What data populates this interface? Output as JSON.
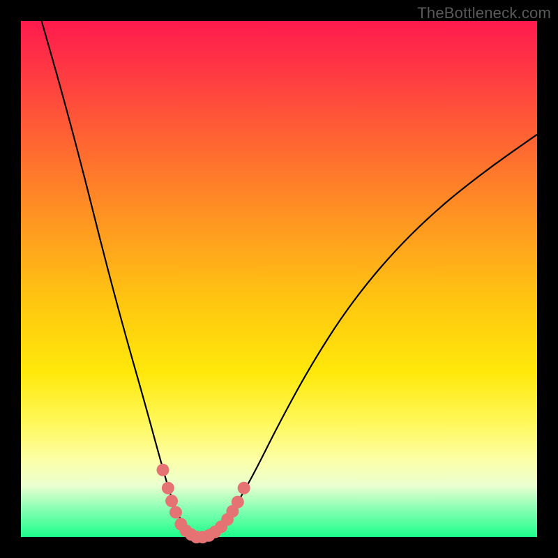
{
  "watermark": "TheBottleneck.com",
  "chart_data": {
    "type": "line",
    "title": "",
    "xlabel": "",
    "ylabel": "",
    "xlim": [
      0,
      1
    ],
    "ylim": [
      0,
      1
    ],
    "series": [
      {
        "name": "bottleneck-curve",
        "x": [
          0.04,
          0.08,
          0.12,
          0.16,
          0.2,
          0.24,
          0.27,
          0.29,
          0.31,
          0.33,
          0.35,
          0.37,
          0.39,
          0.41,
          0.45,
          0.5,
          0.56,
          0.63,
          0.71,
          0.8,
          0.9,
          1.0
        ],
        "y": [
          1.0,
          0.86,
          0.71,
          0.55,
          0.4,
          0.26,
          0.15,
          0.08,
          0.03,
          0.005,
          0.0,
          0.005,
          0.02,
          0.05,
          0.12,
          0.22,
          0.33,
          0.44,
          0.54,
          0.63,
          0.71,
          0.78
        ]
      }
    ],
    "markers": {
      "name": "highlight-dots",
      "color": "#e57373",
      "points": [
        {
          "x": 0.275,
          "y": 0.13
        },
        {
          "x": 0.285,
          "y": 0.095
        },
        {
          "x": 0.292,
          "y": 0.07
        },
        {
          "x": 0.3,
          "y": 0.048
        },
        {
          "x": 0.31,
          "y": 0.025
        },
        {
          "x": 0.32,
          "y": 0.012
        },
        {
          "x": 0.33,
          "y": 0.005
        },
        {
          "x": 0.34,
          "y": 0.0
        },
        {
          "x": 0.352,
          "y": 0.0
        },
        {
          "x": 0.364,
          "y": 0.003
        },
        {
          "x": 0.376,
          "y": 0.01
        },
        {
          "x": 0.388,
          "y": 0.02
        },
        {
          "x": 0.4,
          "y": 0.034
        },
        {
          "x": 0.41,
          "y": 0.05
        },
        {
          "x": 0.42,
          "y": 0.068
        },
        {
          "x": 0.432,
          "y": 0.095
        }
      ]
    }
  }
}
